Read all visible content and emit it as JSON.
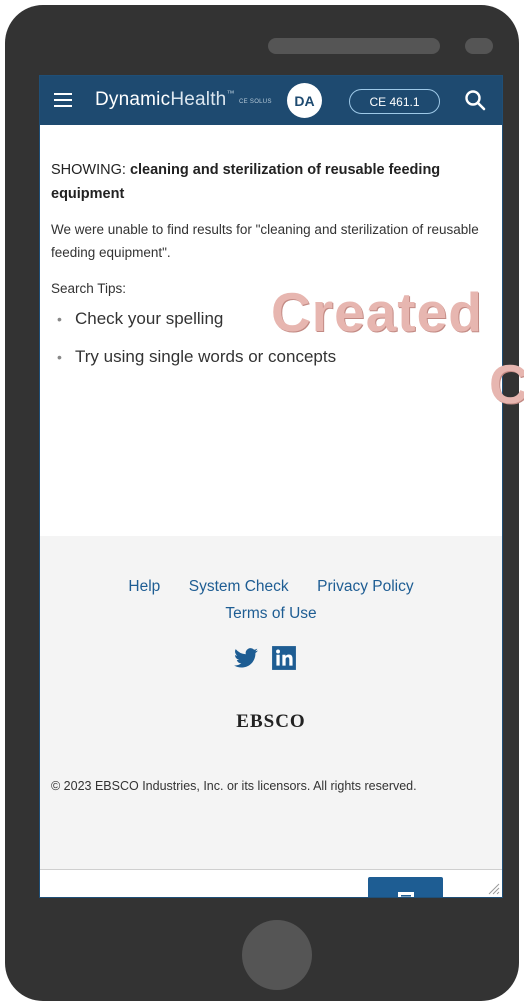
{
  "header": {
    "brand_part1": "Dynamic",
    "brand_part2": "Health",
    "brand_tm": "™",
    "brand_sub": "CE SOLUS",
    "avatar_initials": "DA",
    "ce_badge": "CE 461.1"
  },
  "search": {
    "showing_prefix": "SHOWING: ",
    "query": "cleaning and sterilization of reusable feeding equipment",
    "no_results": "We were unable to find results for \"cleaning and sterilization of reusable feeding equipment\".",
    "tips_heading": "Search Tips:",
    "tips": [
      "Check your spelling",
      "Try using single words or concepts"
    ]
  },
  "footer": {
    "links": [
      "Help",
      "System Check",
      "Privacy Policy",
      "Terms of Use"
    ],
    "logo_text": "EBSCO",
    "copyright": "© 2023 EBSCO Industries, Inc. or its licensors. All rights reserved."
  },
  "watermark": {
    "text": "Created",
    "fragment": "C"
  },
  "icons": [
    "menu-icon",
    "search-icon",
    "twitter-icon",
    "linkedin-icon",
    "chat-icon"
  ],
  "colors": {
    "header_bg": "#1e4a70",
    "link": "#1e5d93",
    "phone_body": "#333333",
    "watermark": "#e7b6b0"
  }
}
